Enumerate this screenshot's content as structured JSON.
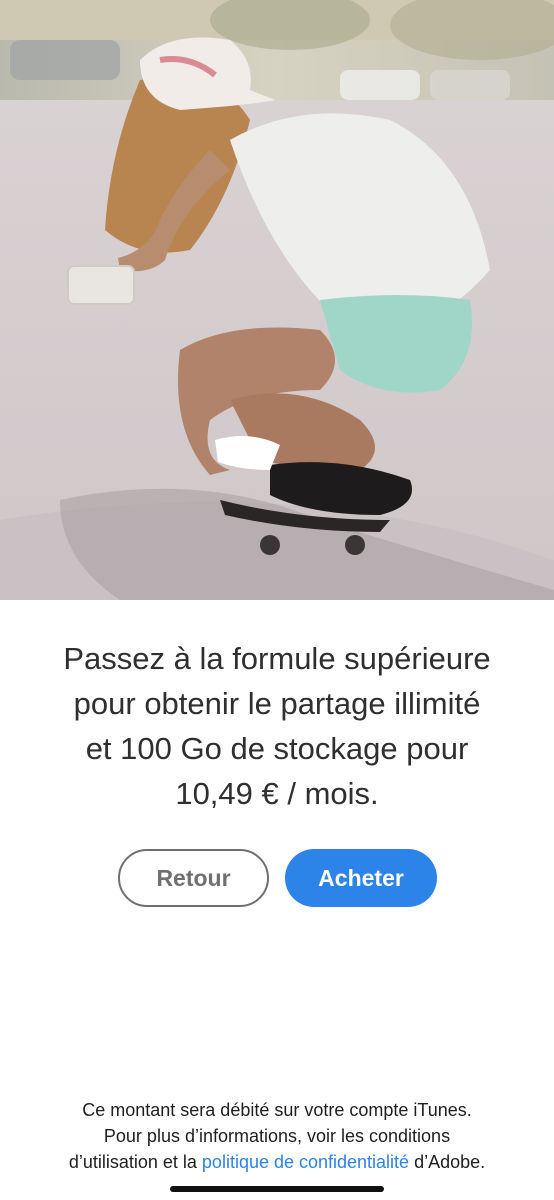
{
  "promo": {
    "lines": [
      "Passez à la formule supérieure",
      "pour obtenir le partage illimité",
      "et 100 Go de stockage pour",
      "10,49 € / mois."
    ]
  },
  "buttons": {
    "back_label": "Retour",
    "buy_label": "Acheter"
  },
  "footer": {
    "line1": "Ce montant sera débité sur votre compte iTunes.",
    "line2": "Pour plus d’informations, voir les conditions",
    "line3_prefix": "d’utilisation et la ",
    "privacy_link": "politique de confidentialité",
    "line3_suffix": " d’Adobe."
  },
  "colors": {
    "accent": "#2d84e8",
    "secondary_button_border": "#707070"
  }
}
